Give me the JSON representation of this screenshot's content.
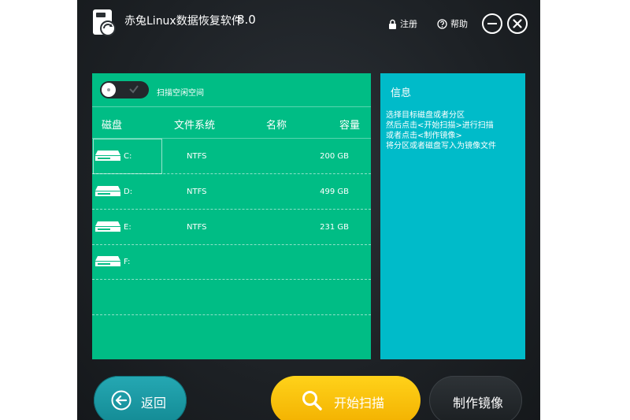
{
  "header": {
    "title": "赤兔Linux数据恢复软件",
    "version": "8.0",
    "register_label": "注册",
    "help_label": "帮助"
  },
  "disk_panel": {
    "toggle_label": "扫描空闲空间",
    "toggle_on": false,
    "columns": [
      "磁盘",
      "文件系统",
      "名称",
      "容量"
    ],
    "rows": [
      {
        "letter": "C:",
        "fs": "NTFS",
        "name": "",
        "size": "200 GB",
        "selected": true
      },
      {
        "letter": "D:",
        "fs": "NTFS",
        "name": "",
        "size": "499 GB",
        "selected": false
      },
      {
        "letter": "E:",
        "fs": "NTFS",
        "name": "",
        "size": "231 GB",
        "selected": false
      },
      {
        "letter": "F:",
        "fs": "",
        "name": "",
        "size": "",
        "selected": false
      }
    ]
  },
  "info_panel": {
    "title": "信息",
    "lines": [
      "选择目标磁盘或者分区",
      "然后点击<开始扫描>进行扫描",
      "或者点击<制作镜像>",
      "将分区或者磁盘写入为镜像文件"
    ]
  },
  "buttons": {
    "back_label": "返回",
    "scan_label": "开始扫描",
    "image_label": "制作镜像"
  },
  "colors": {
    "disk_panel_bg": "#00bd85",
    "info_panel_bg": "#00bbc9",
    "scan_button": "#ffc20e",
    "back_button": "#1d9aa5",
    "window_bg": "#22272b"
  },
  "icons": {
    "logo": "disk-recovery-logo-icon",
    "register": "lock-icon",
    "help": "help-circle-icon",
    "minimize": "minimize-icon",
    "close": "close-icon",
    "drive": "hard-drive-icon",
    "back": "back-arrow-icon",
    "scan": "magnifier-icon",
    "toggle_check": "check-icon"
  }
}
